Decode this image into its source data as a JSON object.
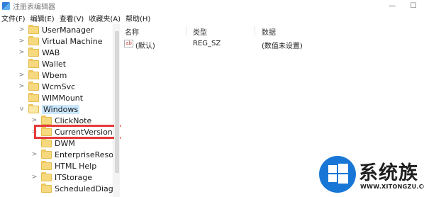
{
  "window": {
    "title": "注册表编辑器",
    "minimize_glyph": "—",
    "maximize_glyph": "☐"
  },
  "menu": [
    "文件(F)",
    "编辑(E)",
    "查看(V)",
    "收藏夹(A)",
    "帮助(H)"
  ],
  "tree": [
    {
      "label": "UserManager",
      "expander": ">"
    },
    {
      "label": "Virtual Machine",
      "expander": ">"
    },
    {
      "label": "WAB",
      "expander": ">"
    },
    {
      "label": "Wallet",
      "expander": ""
    },
    {
      "label": "Wbem",
      "expander": ">"
    },
    {
      "label": "WcmSvc",
      "expander": ">"
    },
    {
      "label": "WIMMount",
      "expander": ""
    },
    {
      "label": "Windows",
      "expander": "v",
      "selected": true
    },
    {
      "label": "ClickNote",
      "expander": ">"
    },
    {
      "label": "CurrentVersion",
      "expander": ">",
      "highlighted": true
    },
    {
      "label": "DWM",
      "expander": ""
    },
    {
      "label": "EnterpriseResour",
      "expander": ">"
    },
    {
      "label": "HTML Help",
      "expander": ""
    },
    {
      "label": "ITStorage",
      "expander": ">"
    },
    {
      "label": "ScheduledDiagno",
      "expander": ""
    }
  ],
  "list": {
    "columns": [
      "名称",
      "类型",
      "数据"
    ],
    "rows": [
      {
        "icon": "string-value-icon",
        "icon_text": "ab",
        "name": "(默认)",
        "type": "REG_SZ",
        "data": "(数值未设置)"
      }
    ]
  },
  "watermark": {
    "text": "系统族",
    "url": "WWW.XITONGZU.COM"
  },
  "colors": {
    "selection": "#cce8ff",
    "highlight_box": "#e53a3a",
    "folder": "#f6d97f",
    "watermark_logo": "#1877d6"
  }
}
